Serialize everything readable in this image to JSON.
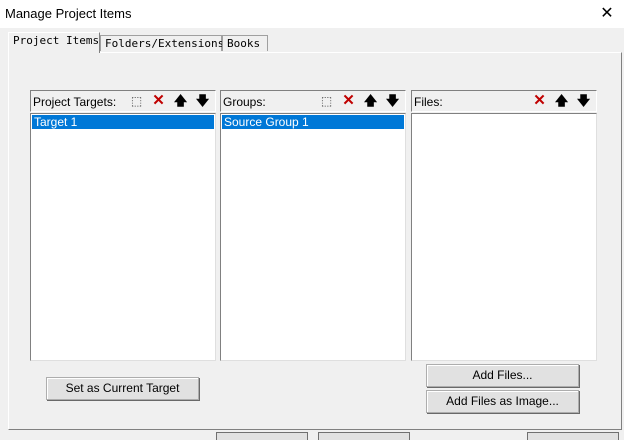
{
  "window": {
    "title": "Manage Project Items"
  },
  "tabs": [
    {
      "label": "Project Items"
    },
    {
      "label": "Folders/Extensions"
    },
    {
      "label": "Books"
    }
  ],
  "project_targets": {
    "label": "Project Targets:",
    "items": [
      {
        "label": "Target 1",
        "selected": true
      }
    ]
  },
  "groups": {
    "label": "Groups:",
    "items": [
      {
        "label": "Source Group 1",
        "selected": true
      }
    ]
  },
  "files": {
    "label": "Files:",
    "items": []
  },
  "buttons": {
    "set_current_target": "Set as Current Target",
    "add_files": "Add Files...",
    "add_files_as_image": "Add Files as Image..."
  },
  "icons": {
    "new": "new-item-icon",
    "delete": "delete-icon",
    "move_up": "arrow-up-icon",
    "move_down": "arrow-down-icon",
    "close": "close-icon"
  },
  "colors": {
    "selection": "#0078d7",
    "delete": "#c00000",
    "background": "#f0f0f0"
  }
}
